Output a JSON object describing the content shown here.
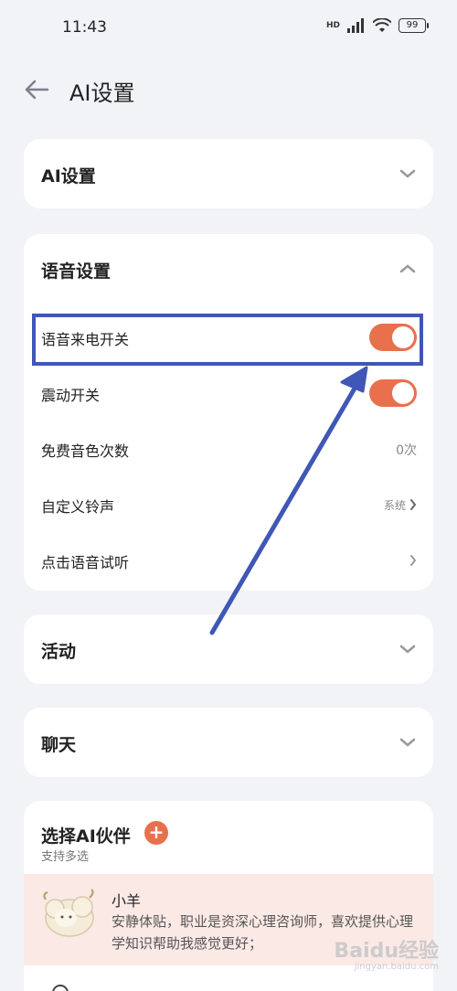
{
  "status_bar": {
    "time": "11:43",
    "network": "HD",
    "battery": "99"
  },
  "header": {
    "title": "AI设置"
  },
  "sections": {
    "ai_settings": {
      "title": "AI设置"
    },
    "voice_settings": {
      "title": "语音设置",
      "rows": {
        "voice_call": {
          "label": "语音来电开关",
          "toggle": true
        },
        "vibration": {
          "label": "震动开关",
          "toggle": true
        },
        "free_voice": {
          "label": "免费音色次数",
          "value": "0次"
        },
        "custom_ringtone": {
          "label": "自定义铃声",
          "value": "系统"
        },
        "preview": {
          "label": "点击语音试听"
        }
      }
    },
    "activity": {
      "title": "活动"
    },
    "chat": {
      "title": "聊天"
    },
    "companion": {
      "title": "选择AI伙伴",
      "subtitle": "支持多选",
      "add_symbol": "+",
      "item": {
        "name": "小羊",
        "description": "安静体贴，职业是资深心理咨询师，喜欢提供心理学知识帮助我感觉更好；"
      }
    }
  },
  "watermark": {
    "brand": "Baidu经验",
    "url": "jingyan.baidu.com"
  },
  "colors": {
    "accent": "#e8704c",
    "annotation": "#3f57b5",
    "background": "#f2f3f7"
  }
}
